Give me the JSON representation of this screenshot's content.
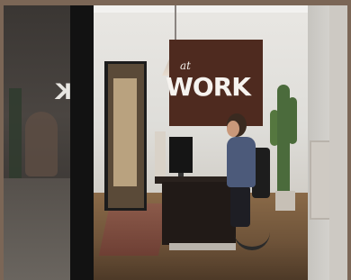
{
  "scene": {
    "glass_sign_text": "K",
    "wall_sign_small": "at",
    "wall_sign_main": "WORK"
  }
}
